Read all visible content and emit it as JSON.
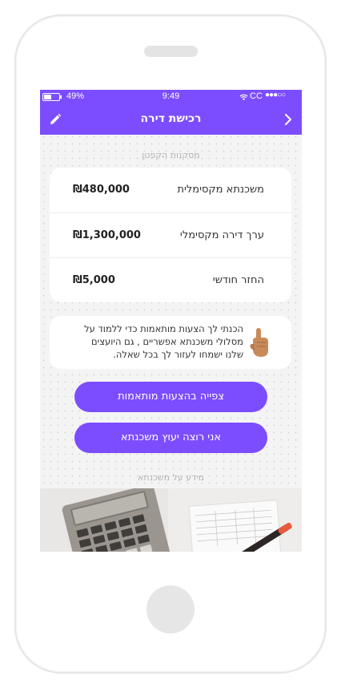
{
  "status_bar": {
    "battery": "49%",
    "time": "9:49",
    "carrier": "CC",
    "signal_dots": "●●●○○"
  },
  "nav": {
    "title": "רכישת דירה",
    "edit_icon": "pencil-icon",
    "forward_icon": "chevron-right-icon"
  },
  "conclusions": {
    "heading": "מסקנות הקפטן",
    "rows": [
      {
        "label": "משכנתא מקסימלית",
        "value": "₪480,000"
      },
      {
        "label": "ערך דירה מקסימלי",
        "value": "₪1,300,000"
      },
      {
        "label": "החזר חודשי",
        "value": "₪5,000"
      }
    ]
  },
  "info": {
    "icon": "pointing-hand-icon",
    "lines": [
      "הכנתי לך הצעות מותאמות כדי ללמוד על",
      "מסלולי משכנתא אפשריים , גם היועצים",
      "שלנו ישמחו לעזור לך בכל שאלה."
    ]
  },
  "actions": {
    "view_offers": "צפייה בהצעות מותאמות",
    "advisor": "אני רוצה יעוץ משכנתא"
  },
  "mortgage_info": {
    "heading": "מידע על משכנתא"
  },
  "colors": {
    "accent": "#7c4dff",
    "background": "#f4f4f4"
  }
}
